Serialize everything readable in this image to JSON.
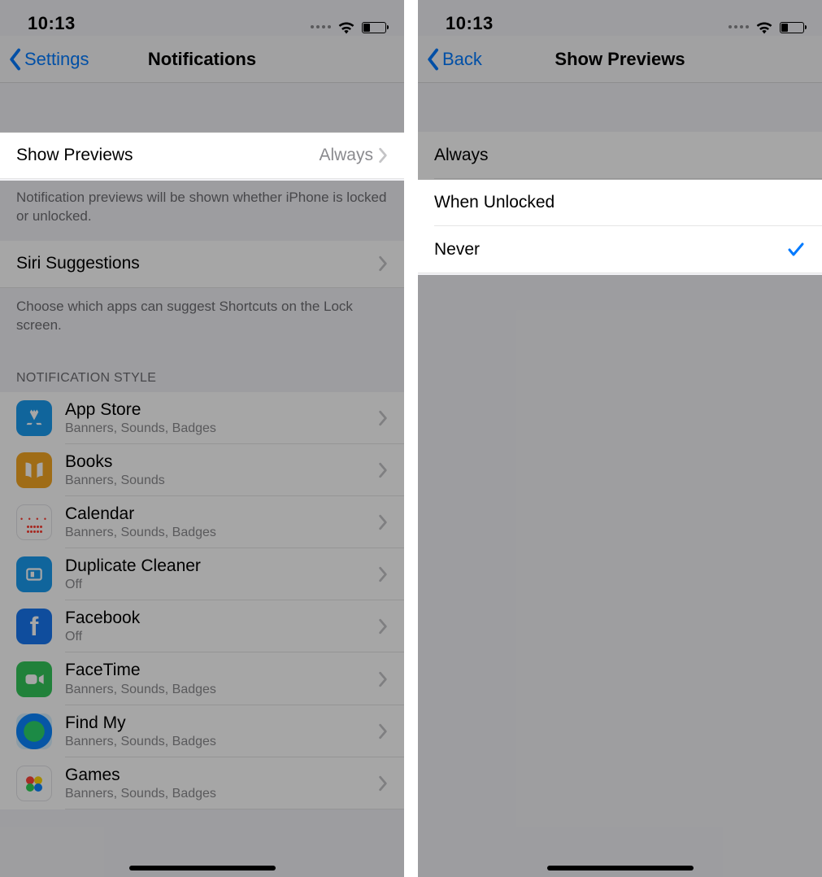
{
  "status": {
    "time": "10:13"
  },
  "left": {
    "back_label": "Settings",
    "title": "Notifications",
    "show_previews": {
      "label": "Show Previews",
      "value": "Always"
    },
    "previews_footer": "Notification previews will be shown whether iPhone is locked or unlocked.",
    "siri": {
      "label": "Siri Suggestions"
    },
    "siri_footer": "Choose which apps can suggest Shortcuts on the Lock screen.",
    "style_header": "NOTIFICATION STYLE",
    "apps": [
      {
        "name": "App Store",
        "sub": "Banners, Sounds, Badges",
        "icon": "appstore"
      },
      {
        "name": "Books",
        "sub": "Banners, Sounds",
        "icon": "books"
      },
      {
        "name": "Calendar",
        "sub": "Banners, Sounds, Badges",
        "icon": "calendar"
      },
      {
        "name": "Duplicate Cleaner",
        "sub": "Off",
        "icon": "dup"
      },
      {
        "name": "Facebook",
        "sub": "Off",
        "icon": "fb"
      },
      {
        "name": "FaceTime",
        "sub": "Banners, Sounds, Badges",
        "icon": "facetime"
      },
      {
        "name": "Find My",
        "sub": "Banners, Sounds, Badges",
        "icon": "findmy"
      },
      {
        "name": "Games",
        "sub": "Banners, Sounds, Badges",
        "icon": "games"
      }
    ]
  },
  "right": {
    "back_label": "Back",
    "title": "Show Previews",
    "options": [
      {
        "label": "Always",
        "selected": false
      },
      {
        "label": "When Unlocked",
        "selected": false
      },
      {
        "label": "Never",
        "selected": true
      }
    ]
  }
}
